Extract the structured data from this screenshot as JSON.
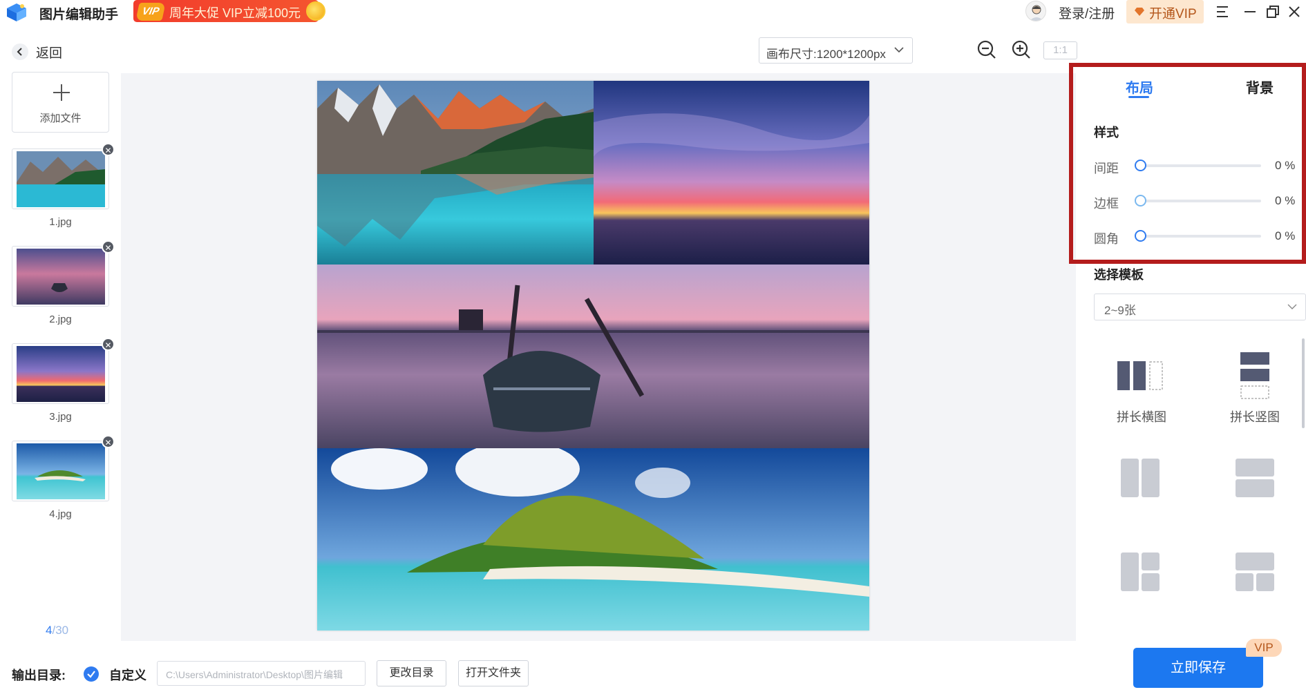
{
  "app": {
    "title": "图片编辑助手",
    "promo_badge": "VIP",
    "promo_text": "周年大促 VIP立减100元"
  },
  "header": {
    "login_label": "登录/注册",
    "vip_label": "开通VIP"
  },
  "nav": {
    "back_label": "返回"
  },
  "files": {
    "add_label": "添加文件",
    "items": [
      {
        "name": "1.jpg"
      },
      {
        "name": "2.jpg"
      },
      {
        "name": "3.jpg"
      },
      {
        "name": "4.jpg"
      }
    ],
    "count_current": "4",
    "count_total": "/30"
  },
  "canvas": {
    "size_label": "画布尺寸:1200*1200px",
    "ratio_label": "1:1"
  },
  "panel": {
    "tabs": [
      {
        "label": "布局",
        "active": true
      },
      {
        "label": "背景",
        "active": false
      }
    ],
    "style_title": "样式",
    "sliders": [
      {
        "label": "间距",
        "value": "0",
        "unit": "%"
      },
      {
        "label": "边框",
        "value": "0",
        "unit": "%"
      },
      {
        "label": "圆角",
        "value": "0",
        "unit": "%"
      }
    ],
    "template_title": "选择模板",
    "template_select": "2~9张",
    "templates": [
      {
        "label": "拼长横图"
      },
      {
        "label": "拼长竖图"
      }
    ]
  },
  "footer": {
    "output_label": "输出目录:",
    "custom_label": "自定义",
    "path_value": "C:\\Users\\Administrator\\Desktop\\图片编辑",
    "change_dir_label": "更改目录",
    "open_folder_label": "打开文件夹",
    "save_label": "立即保存",
    "save_badge": "VIP"
  },
  "colors": {
    "accent": "#2f7bf0",
    "save_button": "#1c78f0",
    "highlight": "#b41c1c",
    "promo": "#f23c2c"
  }
}
